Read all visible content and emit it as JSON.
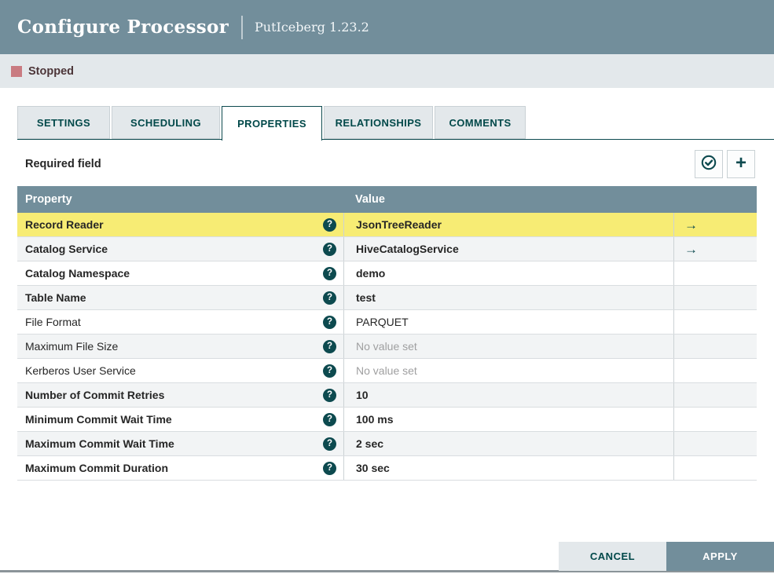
{
  "header": {
    "title": "Configure Processor",
    "subtitle": "PutIceberg 1.23.2"
  },
  "status": {
    "label": "Stopped",
    "state_color": "#c97b81"
  },
  "tabs": [
    {
      "label": "SETTINGS",
      "active": false
    },
    {
      "label": "SCHEDULING",
      "active": false
    },
    {
      "label": "PROPERTIES",
      "active": true
    },
    {
      "label": "RELATIONSHIPS",
      "active": false
    },
    {
      "label": "COMMENTS",
      "active": false
    }
  ],
  "toolbar": {
    "required_label": "Required field",
    "verify_icon": "check-circle-icon",
    "add_icon": "plus-icon"
  },
  "table": {
    "columns": [
      "Property",
      "Value"
    ],
    "help_glyph": "?",
    "goto_glyph": "→",
    "rows": [
      {
        "name": "Record Reader",
        "value": "JsonTreeReader",
        "required": true,
        "unset": false,
        "has_goto": true,
        "selected": true
      },
      {
        "name": "Catalog Service",
        "value": "HiveCatalogService",
        "required": true,
        "unset": false,
        "has_goto": true,
        "selected": false
      },
      {
        "name": "Catalog Namespace",
        "value": "demo",
        "required": true,
        "unset": false,
        "has_goto": false,
        "selected": false
      },
      {
        "name": "Table Name",
        "value": "test",
        "required": true,
        "unset": false,
        "has_goto": false,
        "selected": false
      },
      {
        "name": "File Format",
        "value": "PARQUET",
        "required": false,
        "unset": false,
        "has_goto": false,
        "selected": false
      },
      {
        "name": "Maximum File Size",
        "value": "No value set",
        "required": false,
        "unset": true,
        "has_goto": false,
        "selected": false
      },
      {
        "name": "Kerberos User Service",
        "value": "No value set",
        "required": false,
        "unset": true,
        "has_goto": false,
        "selected": false
      },
      {
        "name": "Number of Commit Retries",
        "value": "10",
        "required": true,
        "unset": false,
        "has_goto": false,
        "selected": false
      },
      {
        "name": "Minimum Commit Wait Time",
        "value": "100 ms",
        "required": true,
        "unset": false,
        "has_goto": false,
        "selected": false
      },
      {
        "name": "Maximum Commit Wait Time",
        "value": "2 sec",
        "required": true,
        "unset": false,
        "has_goto": false,
        "selected": false
      },
      {
        "name": "Maximum Commit Duration",
        "value": "30 sec",
        "required": true,
        "unset": false,
        "has_goto": false,
        "selected": false
      }
    ]
  },
  "footer": {
    "cancel_label": "CANCEL",
    "apply_label": "APPLY"
  },
  "colors": {
    "header_bg": "#728e9b",
    "accent_teal": "#0d4a4f",
    "status_bar_bg": "#e3e8eb",
    "selected_row": "#f7ec74",
    "alt_row": "#f2f4f5",
    "stopped_icon": "#c97b81"
  }
}
